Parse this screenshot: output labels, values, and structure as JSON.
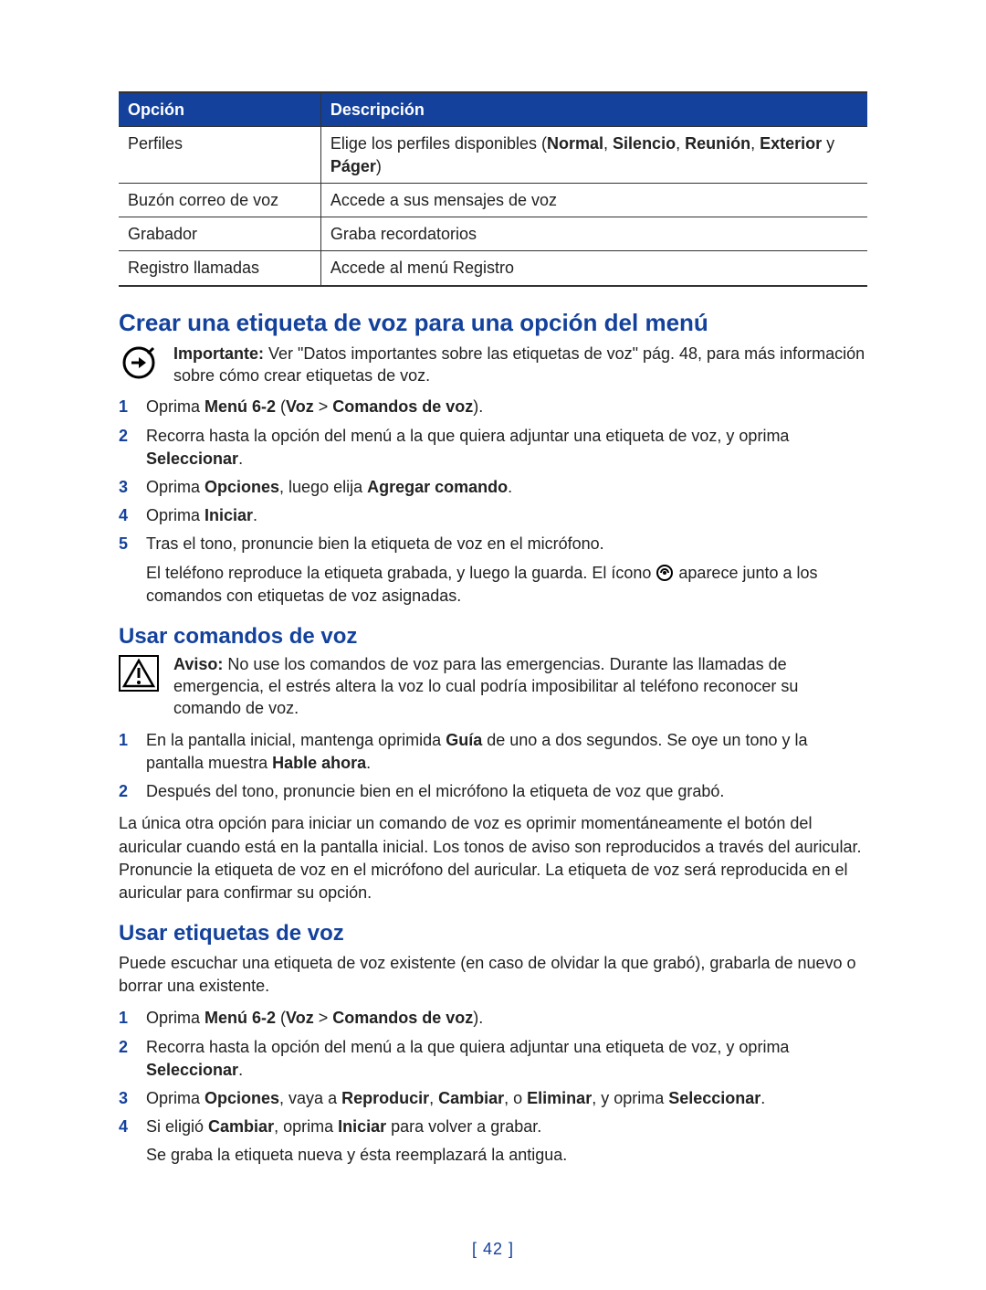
{
  "table": {
    "headers": {
      "opt": "Opción",
      "desc": "Descripción"
    },
    "rows": [
      {
        "opt": "Perfiles",
        "desc_pre": "Elige los perfiles disponibles (",
        "desc_b1": "Normal",
        "desc_s1": ", ",
        "desc_b2": "Silencio",
        "desc_s2": ", ",
        "desc_b3": "Reunión",
        "desc_s3": ", ",
        "desc_b4": "Exterior",
        "desc_s4": " y ",
        "desc_b5": "Páger",
        "desc_post": ")"
      },
      {
        "opt": "Buzón correo de voz",
        "desc": "Accede a sus mensajes de voz"
      },
      {
        "opt": "Grabador",
        "desc": "Graba recordatorios"
      },
      {
        "opt": "Registro llamadas",
        "desc": "Accede al menú Registro"
      }
    ]
  },
  "sec1": {
    "title": "Crear una etiqueta de voz para una opción del menú",
    "note_lead": "Importante:",
    "note_body": " Ver \"Datos importantes sobre las etiquetas de voz\" pág. 48, para más información sobre cómo crear etiquetas de voz.",
    "steps": {
      "s1_a": "Oprima ",
      "s1_b": "Menú 6-2",
      "s1_c": " (",
      "s1_d": "Voz",
      "s1_e": " > ",
      "s1_f": "Comandos de voz",
      "s1_g": ").",
      "s2_a": "Recorra hasta la opción del menú a la que quiera adjuntar una etiqueta de voz, y oprima ",
      "s2_b": "Seleccionar",
      "s2_c": ".",
      "s3_a": "Oprima ",
      "s3_b": "Opciones",
      "s3_c": ", luego elija ",
      "s3_d": "Agregar comando",
      "s3_e": ".",
      "s4_a": "Oprima ",
      "s4_b": "Iniciar",
      "s4_c": ".",
      "s5_a": "Tras el tono, pronuncie bien la etiqueta de voz en el micrófono.",
      "s5_sub_a": "El teléfono reproduce la etiqueta grabada, y luego la guarda. El ícono ",
      "s5_sub_b": " aparece junto a los comandos con etiquetas de voz asignadas."
    }
  },
  "sec2": {
    "title": "Usar comandos de voz",
    "note_lead": "Aviso:",
    "note_body": " No use los comandos de voz para las emergencias. Durante las llamadas de emergencia, el estrés altera la voz lo cual podría imposibilitar al teléfono reconocer su comando de voz.",
    "steps": {
      "s1_a": "En la pantalla inicial, mantenga oprimida ",
      "s1_b": "Guía",
      "s1_c": " de uno a dos segundos. Se oye un tono y la pantalla muestra ",
      "s1_d": "Hable ahora",
      "s1_e": ".",
      "s2": "Después del tono, pronuncie bien en el micrófono la etiqueta de voz que grabó."
    },
    "para": "La única otra opción para iniciar un comando de voz es oprimir momentáneamente el botón del auricular cuando está en la pantalla inicial. Los tonos de aviso son reproducidos a través del auricular. Pronuncie la etiqueta de voz en el micrófono del auricular. La etiqueta de voz será reproducida en el auricular para confirmar su opción."
  },
  "sec3": {
    "title": "Usar etiquetas de voz",
    "intro": "Puede escuchar una etiqueta de voz existente (en caso de olvidar la que grabó), grabarla de nuevo o borrar una existente.",
    "steps": {
      "s1_a": "Oprima ",
      "s1_b": "Menú 6-2",
      "s1_c": " (",
      "s1_d": "Voz",
      "s1_e": " > ",
      "s1_f": "Comandos de voz",
      "s1_g": ").",
      "s2_a": "Recorra hasta la opción del menú a la que quiera adjuntar una etiqueta de voz, y oprima ",
      "s2_b": "Seleccionar",
      "s2_c": ".",
      "s3_a": "Oprima ",
      "s3_b": "Opciones",
      "s3_c": ", vaya a ",
      "s3_d": "Reproducir",
      "s3_e": ", ",
      "s3_f": "Cambiar",
      "s3_g": ", o ",
      "s3_h": "Eliminar",
      "s3_i": ", y oprima ",
      "s3_j": "Seleccionar",
      "s3_k": ".",
      "s4_a": "Si eligió ",
      "s4_b": "Cambiar",
      "s4_c": ", oprima ",
      "s4_d": "Iniciar",
      "s4_e": " para volver a grabar.",
      "s4_sub": "Se graba la etiqueta nueva y ésta reemplazará la antigua."
    }
  },
  "page_number": "[ 42 ]"
}
